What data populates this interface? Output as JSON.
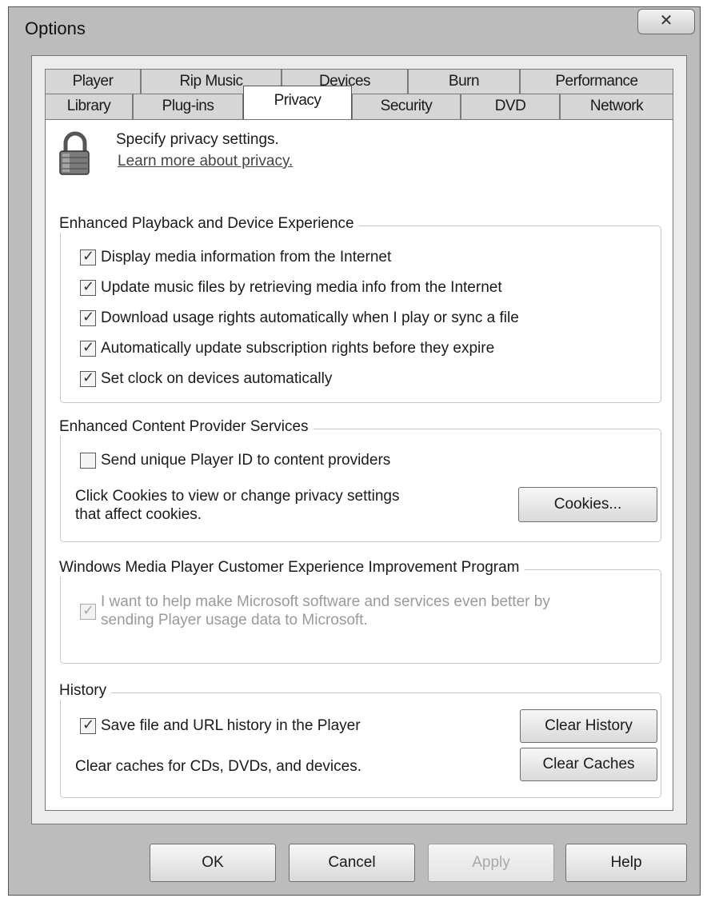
{
  "window": {
    "title": "Options",
    "close_icon": "close-icon"
  },
  "tabs": {
    "top_row": [
      "Player",
      "Rip Music",
      "Devices",
      "Burn",
      "Performance"
    ],
    "bottom_row": [
      "Library",
      "Plug-ins",
      "Privacy",
      "Security",
      "DVD",
      "Network"
    ],
    "active": "Privacy"
  },
  "intro": {
    "icon": "lock-icon",
    "title": "Specify privacy settings.",
    "link": "Learn more about privacy."
  },
  "playback_group": {
    "legend": "Enhanced Playback and Device Experience",
    "options": [
      {
        "label": "Display media information from the Internet",
        "checked": true
      },
      {
        "label": "Update music files by retrieving media info from the Internet",
        "checked": true
      },
      {
        "label": "Download usage rights automatically when I play or sync a file",
        "checked": true
      },
      {
        "label": "Automatically update subscription rights before they expire",
        "checked": true
      },
      {
        "label": "Set clock on devices automatically",
        "checked": true
      }
    ]
  },
  "content_group": {
    "legend": "Enhanced Content Provider Services",
    "send_id": {
      "label": "Send unique Player ID to content providers",
      "checked": false
    },
    "cookies_text_line1": "Click Cookies to view or change privacy settings",
    "cookies_text_line2": "that affect cookies.",
    "cookies_button": "Cookies..."
  },
  "ceip_group": {
    "legend": "Windows Media Player Customer Experience Improvement Program",
    "option_line1": "I want to help make Microsoft software and services even better by",
    "option_line2": "sending Player usage data to Microsoft.",
    "checked": true,
    "enabled": false
  },
  "history_group": {
    "legend": "History",
    "save_history": {
      "label": "Save file and URL history in the Player",
      "checked": true
    },
    "clear_history_button": "Clear History",
    "caches_text": "Clear caches for CDs, DVDs, and devices.",
    "clear_caches_button": "Clear Caches"
  },
  "footer": {
    "ok": "OK",
    "cancel": "Cancel",
    "apply": "Apply",
    "help": "Help",
    "apply_enabled": false
  }
}
